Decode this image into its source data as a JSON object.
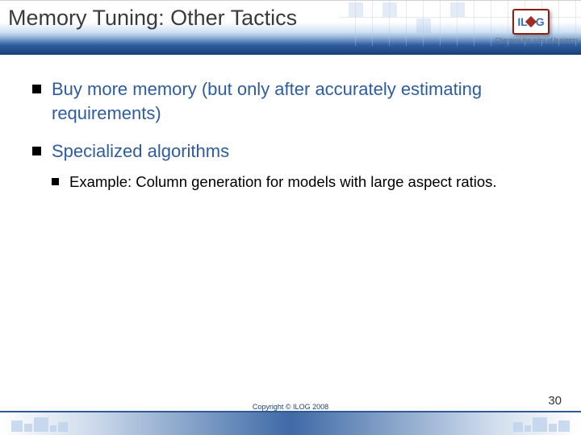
{
  "header": {
    "title": "Memory Tuning: Other Tactics",
    "logo": {
      "text_left": "I L",
      "text_right": "G",
      "tagline": "Changing the rules of business"
    }
  },
  "bullets": [
    {
      "text": "Buy more memory (but only after accurately estimating requirements)"
    },
    {
      "text": "Specialized algorithms",
      "sub": [
        {
          "text": "Example: Column generation for models with large aspect ratios."
        }
      ]
    }
  ],
  "footer": {
    "copyright": "Copyright © ILOG 2008",
    "page_number": "30"
  }
}
